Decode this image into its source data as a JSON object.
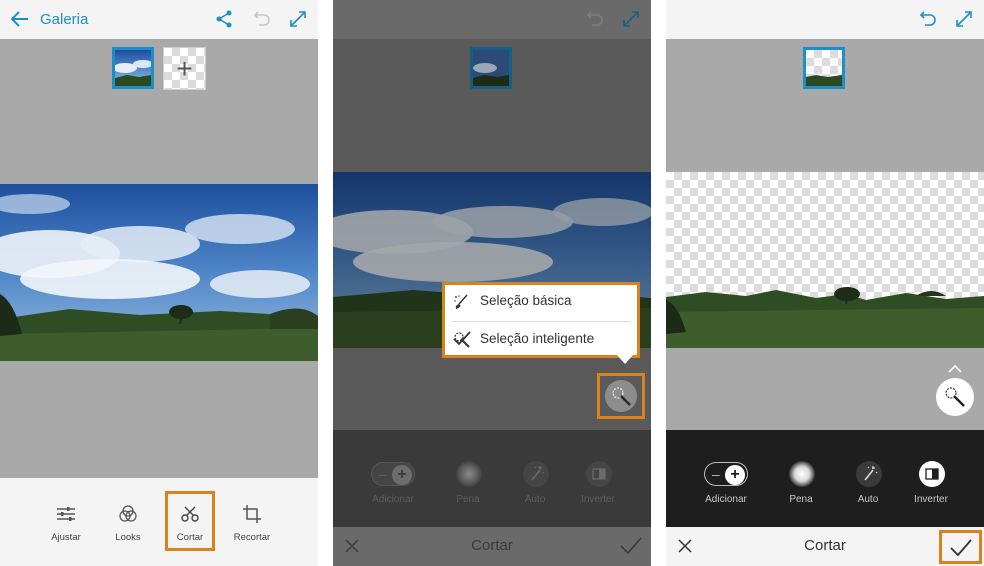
{
  "colors": {
    "accent": "#1b8fc9",
    "highlight": "#d9831c",
    "toolbar_light": "#f4f4f4",
    "workspace_grey": "#a9a9a9",
    "tools_dark": "#1e1e1e"
  },
  "panel1": {
    "header": {
      "back_icon": "arrow-left-icon",
      "title": "Galeria",
      "share_icon": "share-icon",
      "undo_icon": "undo-icon",
      "expand_icon": "expand-icon"
    },
    "layers": {
      "add_icon": "plus-icon"
    },
    "tools": [
      {
        "label": "Ajustar",
        "icon": "sliders-icon"
      },
      {
        "label": "Looks",
        "icon": "looks-icon"
      },
      {
        "label": "Cortar",
        "icon": "scissors-icon",
        "highlighted": true
      },
      {
        "label": "Recortar",
        "icon": "crop-icon"
      }
    ]
  },
  "panel2": {
    "header": {
      "undo_icon": "undo-icon",
      "expand_icon": "expand-icon"
    },
    "selection_menu": {
      "items": [
        {
          "label": "Seleção básica",
          "icon": "brush-icon",
          "selected": false
        },
        {
          "label": "Seleção inteligente",
          "icon": "magic-wand-icon",
          "selected": true
        }
      ]
    },
    "tools": [
      {
        "label": "Adicionar",
        "icon": "add-toggle"
      },
      {
        "label": "Pena",
        "icon": "feather-icon"
      },
      {
        "label": "Auto",
        "icon": "auto-wand-icon"
      },
      {
        "label": "Inverter",
        "icon": "invert-icon"
      }
    ],
    "bottom": {
      "cancel_icon": "close-icon",
      "title": "Cortar",
      "confirm_icon": "check-icon"
    }
  },
  "panel3": {
    "header": {
      "undo_icon": "undo-icon",
      "expand_icon": "expand-icon"
    },
    "tools": [
      {
        "label": "Adicionar",
        "icon": "add-toggle"
      },
      {
        "label": "Pena",
        "icon": "feather-icon"
      },
      {
        "label": "Auto",
        "icon": "auto-wand-icon"
      },
      {
        "label": "Inverter",
        "icon": "invert-icon"
      }
    ],
    "bottom": {
      "cancel_icon": "close-icon",
      "title": "Cortar",
      "confirm_icon": "check-icon"
    }
  }
}
